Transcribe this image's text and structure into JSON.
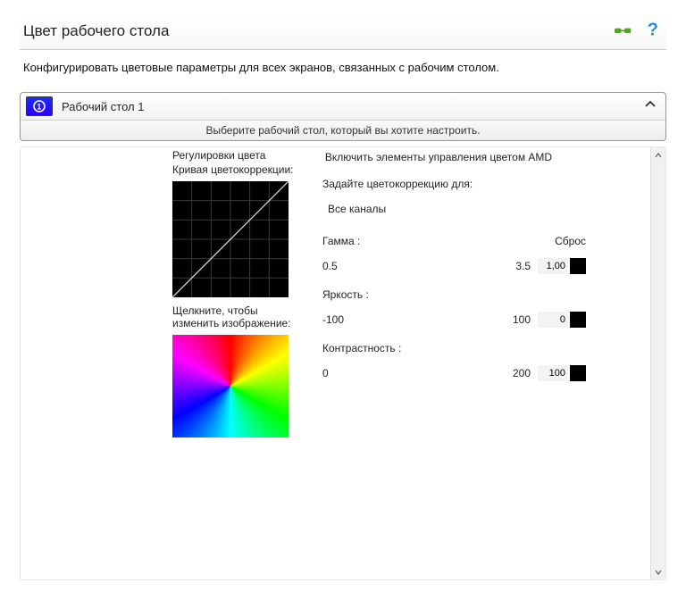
{
  "title": "Цвет рабочего стола",
  "description": "Конфигурировать цветовые параметры для всех экранов, связанных с рабочим столом.",
  "expander": {
    "title": "Рабочий стол 1",
    "badge": "1",
    "caption": "Выберите рабочий стол, который вы хотите настроить."
  },
  "left": {
    "section_title": "Регулировки цвета",
    "curve_label": "Кривая цветокоррекции:",
    "click_text": "Щелкните, чтобы изменить изображение:"
  },
  "right": {
    "amd_title": "Включить элементы управления цветом AMD",
    "set_for": "Задайте цветокоррекцию для:",
    "channels": "Все каналы",
    "reset": "Сброс",
    "gamma": {
      "label": "Гамма :",
      "min": "0.5",
      "max": "3.5",
      "value": "1,00"
    },
    "brightness": {
      "label": "Яркость :",
      "min": "-100",
      "max": "100",
      "value": "0"
    },
    "contrast": {
      "label": "Контрастность :",
      "min": "0",
      "max": "200",
      "value": "100"
    }
  }
}
